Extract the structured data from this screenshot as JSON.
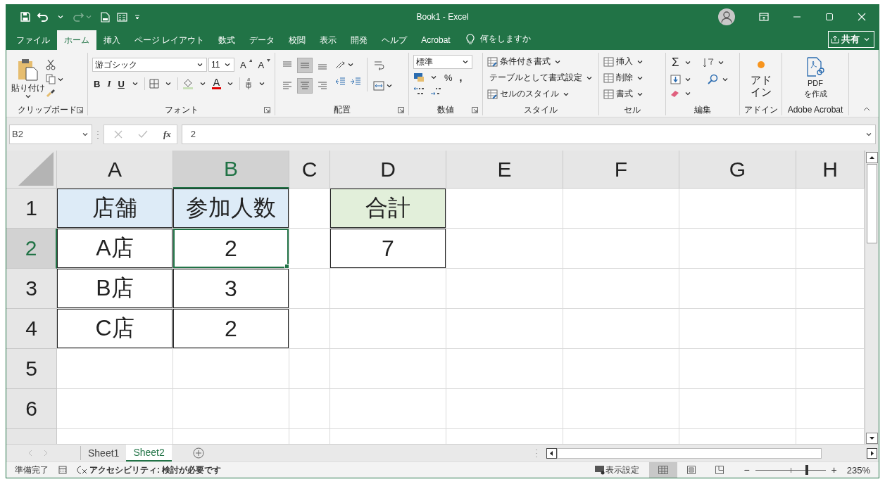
{
  "window": {
    "title": "Book1 - Excel"
  },
  "menu_tabs": [
    {
      "label": "ファイル",
      "selected": false
    },
    {
      "label": "ホーム",
      "selected": true
    },
    {
      "label": "挿入",
      "selected": false
    },
    {
      "label": "ページ レイアウト",
      "selected": false
    },
    {
      "label": "数式",
      "selected": false
    },
    {
      "label": "データ",
      "selected": false
    },
    {
      "label": "校閲",
      "selected": false
    },
    {
      "label": "表示",
      "selected": false
    },
    {
      "label": "開発",
      "selected": false
    },
    {
      "label": "ヘルプ",
      "selected": false
    },
    {
      "label": "Acrobat",
      "selected": false
    }
  ],
  "tell_me": "何をしますか",
  "share": "共有",
  "ribbon": {
    "clipboard": {
      "paste": "貼り付け",
      "label": "クリップボード"
    },
    "font": {
      "name": "游ゴシック",
      "size": "11",
      "grow": "A",
      "shrink": "A",
      "bold": "B",
      "italic": "I",
      "underline": "U",
      "font_color": "A",
      "label": "フォント"
    },
    "alignment": {
      "buttons": [
        {
          "kind": "top",
          "selected": false
        },
        {
          "kind": "middle",
          "selected": true
        },
        {
          "kind": "bottom",
          "selected": false
        },
        {
          "kind": "left",
          "selected": false
        },
        {
          "kind": "center",
          "selected": true
        },
        {
          "kind": "right",
          "selected": false
        }
      ],
      "label": "配置"
    },
    "number": {
      "format": "標準",
      "percent": "%",
      "comma": ",",
      "label": "数値"
    },
    "styles": {
      "items": [
        "条件付き書式",
        "テーブルとして書式設定",
        "セルのスタイル"
      ],
      "label": "スタイル"
    },
    "cells": {
      "items": [
        "挿入",
        "削除",
        "書式"
      ],
      "label": "セル"
    },
    "editing": {
      "sum": "Σ",
      "label": "編集"
    },
    "addins": {
      "button": "アドイン",
      "label": "アドイン"
    },
    "acrobat": {
      "button": "PDF\nを作成",
      "label": "Adobe Acrobat"
    }
  },
  "formula_bar": {
    "name_box": "B2",
    "fx": "fx",
    "formula": "2"
  },
  "sheet": {
    "columns": [
      {
        "label": "A",
        "selected": false
      },
      {
        "label": "B",
        "selected": true
      },
      {
        "label": "C",
        "selected": false
      },
      {
        "label": "D",
        "selected": false
      },
      {
        "label": "E",
        "selected": false
      },
      {
        "label": "F",
        "selected": false
      },
      {
        "label": "G",
        "selected": false
      },
      {
        "label": "H",
        "selected": false
      }
    ],
    "rows": [
      {
        "label": "1",
        "selected": false,
        "cells": [
          {
            "text": "店舗",
            "color": "#ddebf7",
            "bordered": true,
            "selected": false
          },
          {
            "text": "参加人数",
            "color": "#ddebf7",
            "bordered": true,
            "selected": false
          },
          {
            "bordered": false,
            "selected": false
          },
          {
            "text": "合計",
            "color": "#e2efda",
            "bordered": true,
            "selected": false
          },
          {
            "bordered": false,
            "selected": false
          },
          {
            "bordered": false,
            "selected": false
          },
          {
            "bordered": false,
            "selected": false
          },
          {
            "bordered": false,
            "selected": false
          }
        ]
      },
      {
        "label": "2",
        "selected": true,
        "cells": [
          {
            "text": "A店",
            "bordered": true,
            "selected": false
          },
          {
            "text": "2",
            "bordered": true,
            "selected": true
          },
          {
            "bordered": false,
            "selected": false
          },
          {
            "text": "7",
            "bordered": true,
            "selected": false
          },
          {
            "bordered": false,
            "selected": false
          },
          {
            "bordered": false,
            "selected": false
          },
          {
            "bordered": false,
            "selected": false
          },
          {
            "bordered": false,
            "selected": false
          }
        ]
      },
      {
        "label": "3",
        "selected": false,
        "cells": [
          {
            "text": "B店",
            "bordered": true,
            "selected": false
          },
          {
            "text": "3",
            "bordered": true,
            "selected": false
          },
          {
            "bordered": false,
            "selected": false
          },
          {
            "bordered": false,
            "selected": false
          },
          {
            "bordered": false,
            "selected": false
          },
          {
            "bordered": false,
            "selected": false
          },
          {
            "bordered": false,
            "selected": false
          },
          {
            "bordered": false,
            "selected": false
          }
        ]
      },
      {
        "label": "4",
        "selected": false,
        "cells": [
          {
            "text": "C店",
            "bordered": true,
            "selected": false
          },
          {
            "text": "2",
            "bordered": true,
            "selected": false
          },
          {
            "bordered": false,
            "selected": false
          },
          {
            "bordered": false,
            "selected": false
          },
          {
            "bordered": false,
            "selected": false
          },
          {
            "bordered": false,
            "selected": false
          },
          {
            "bordered": false,
            "selected": false
          },
          {
            "bordered": false,
            "selected": false
          }
        ]
      },
      {
        "label": "5",
        "selected": false,
        "cells": [
          {
            "bordered": false,
            "selected": false
          },
          {
            "bordered": false,
            "selected": false
          },
          {
            "bordered": false,
            "selected": false
          },
          {
            "bordered": false,
            "selected": false
          },
          {
            "bordered": false,
            "selected": false
          },
          {
            "bordered": false,
            "selected": false
          },
          {
            "bordered": false,
            "selected": false
          },
          {
            "bordered": false,
            "selected": false
          }
        ]
      },
      {
        "label": "6",
        "selected": false,
        "cells": [
          {
            "bordered": false,
            "selected": false
          },
          {
            "bordered": false,
            "selected": false
          },
          {
            "bordered": false,
            "selected": false
          },
          {
            "bordered": false,
            "selected": false
          },
          {
            "bordered": false,
            "selected": false
          },
          {
            "bordered": false,
            "selected": false
          },
          {
            "bordered": false,
            "selected": false
          },
          {
            "bordered": false,
            "selected": false
          }
        ]
      }
    ]
  },
  "sheet_tabs": [
    {
      "label": "Sheet1",
      "selected": false
    },
    {
      "label": "Sheet2",
      "selected": true
    }
  ],
  "status_bar": {
    "status": "準備完了",
    "accessibility": "アクセシビリティ: 検討が必要です",
    "display_settings": "表示設定",
    "views": [
      {
        "kind": "normal",
        "selected": true
      },
      {
        "kind": "page_layout",
        "selected": false
      },
      {
        "kind": "page_break",
        "selected": false
      }
    ],
    "zoom": {
      "minus": "−",
      "plus": "+",
      "level": 0.73,
      "reading": "235%"
    }
  }
}
